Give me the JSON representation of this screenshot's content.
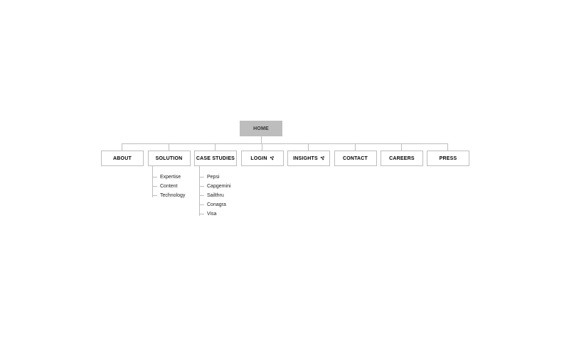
{
  "root": {
    "label": "HOME"
  },
  "nav": {
    "about": {
      "label": "ABOUT",
      "external": false
    },
    "solution": {
      "label": "SOLUTION",
      "external": false
    },
    "case_studies": {
      "label": "CASE STUDIES",
      "external": false
    },
    "login": {
      "label": "LOGIN",
      "external": true
    },
    "insights": {
      "label": "INSIGHTS",
      "external": true
    },
    "contact": {
      "label": "CONTACT",
      "external": false
    },
    "careers": {
      "label": "CAREERS",
      "external": false
    },
    "press": {
      "label": "PRESS",
      "external": false
    }
  },
  "solution_children": [
    {
      "label": "Expertise"
    },
    {
      "label": "Content"
    },
    {
      "label": "Technology"
    }
  ],
  "case_studies_children": [
    {
      "label": "Pepsi"
    },
    {
      "label": "Capgemini"
    },
    {
      "label": "Sailthru"
    },
    {
      "label": "Conagra"
    },
    {
      "label": "Visa"
    }
  ]
}
